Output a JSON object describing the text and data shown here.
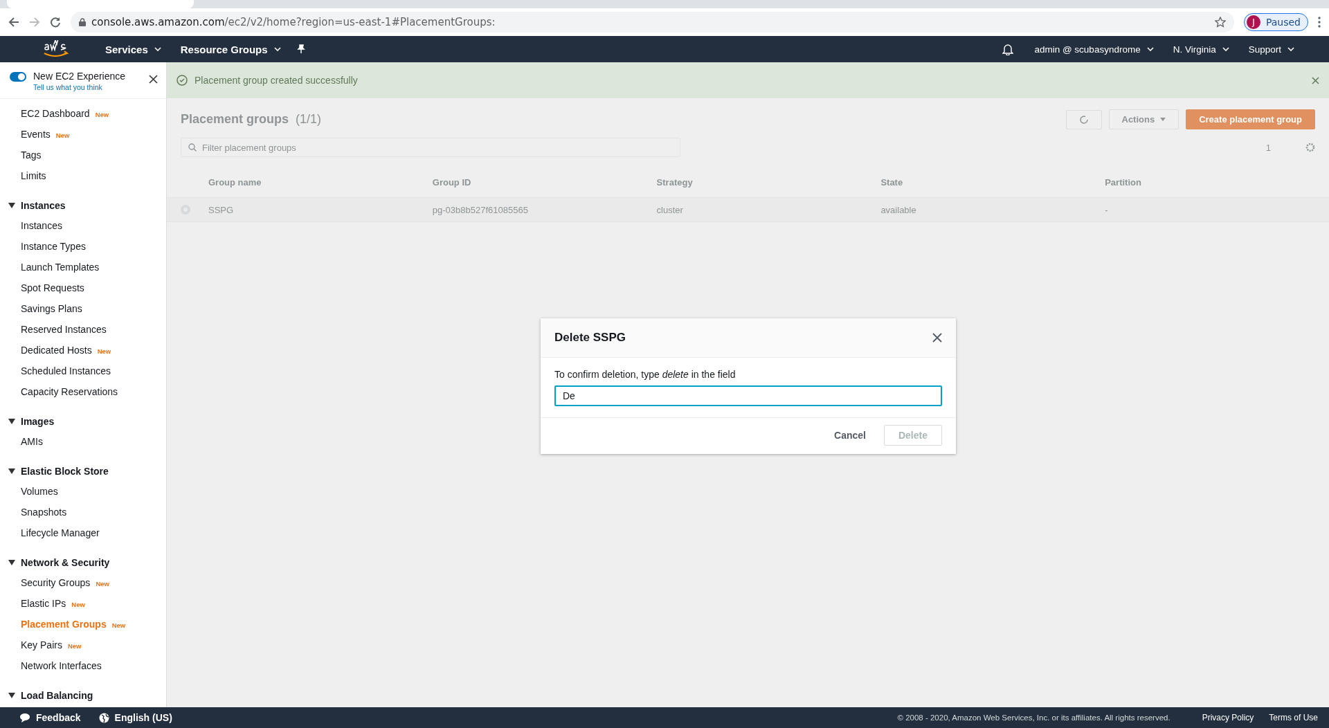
{
  "browser": {
    "url_host": "console.aws.amazon.com",
    "url_path": "/ec2/v2/home?region=us-east-1#PlacementGroups:",
    "profile_initial": "J",
    "profile_label": "Paused"
  },
  "nav": {
    "left": [
      {
        "label": "Services"
      },
      {
        "label": "Resource Groups"
      }
    ],
    "right": [
      {
        "label": "admin @ scubasyndrome"
      },
      {
        "label": "N. Virginia"
      },
      {
        "label": "Support"
      }
    ]
  },
  "sidebar": {
    "toggle": {
      "label": "New EC2 Experience",
      "link": "Tell us what you think",
      "on": true
    },
    "sections": [
      {
        "items": [
          {
            "label": "EC2 Dashboard",
            "badge": "New",
            "selected": false
          },
          {
            "label": "Events",
            "badge": "New",
            "selected": false
          },
          {
            "label": "Tags",
            "selected": false
          },
          {
            "label": "Limits",
            "selected": false
          }
        ]
      },
      {
        "title": "Instances",
        "expanded": true,
        "items": [
          {
            "label": "Instances",
            "selected": false
          },
          {
            "label": "Instance Types",
            "selected": false
          },
          {
            "label": "Launch Templates",
            "selected": false
          },
          {
            "label": "Spot Requests",
            "selected": false
          },
          {
            "label": "Savings Plans",
            "selected": false
          },
          {
            "label": "Reserved Instances",
            "selected": false
          },
          {
            "label": "Dedicated Hosts",
            "badge": "New",
            "selected": false
          },
          {
            "label": "Scheduled Instances",
            "selected": false
          },
          {
            "label": "Capacity Reservations",
            "selected": false
          }
        ]
      },
      {
        "title": "Images",
        "expanded": true,
        "items": [
          {
            "label": "AMIs",
            "selected": false
          }
        ]
      },
      {
        "title": "Elastic Block Store",
        "expanded": true,
        "items": [
          {
            "label": "Volumes",
            "selected": false
          },
          {
            "label": "Snapshots",
            "selected": false
          },
          {
            "label": "Lifecycle Manager",
            "selected": false
          }
        ]
      },
      {
        "title": "Network & Security",
        "expanded": true,
        "items": [
          {
            "label": "Security Groups",
            "badge": "New",
            "selected": false
          },
          {
            "label": "Elastic IPs",
            "badge": "New",
            "selected": false
          },
          {
            "label": "Placement Groups",
            "badge": "New",
            "selected": true
          },
          {
            "label": "Key Pairs",
            "badge": "New",
            "selected": false
          },
          {
            "label": "Network Interfaces",
            "selected": false
          }
        ]
      },
      {
        "title": "Load Balancing",
        "expanded": true
      }
    ]
  },
  "flash": {
    "message": "Placement group created successfully"
  },
  "panel": {
    "title": "Placement groups",
    "count": "(1/1)",
    "actions": "Actions",
    "create": "Create placement group",
    "search_placeholder": "Filter placement groups",
    "page": "1"
  },
  "table": {
    "columns": [
      "Group name",
      "Group ID",
      "Strategy",
      "State",
      "Partition"
    ],
    "rows": [
      {
        "selected": true,
        "cells": [
          "SSPG",
          "pg-03b8b527f61085565",
          "cluster",
          "available",
          "-"
        ]
      }
    ]
  },
  "modal": {
    "title": "Delete SSPG",
    "prompt": "To confirm deletion, type *delete* in the field",
    "value": "De",
    "cancel": "Cancel",
    "confirm": "Delete",
    "confirm_disabled": true
  },
  "footer": {
    "feedback": "Feedback",
    "language": "English (US)",
    "copyright": "© 2008 - 2020, Amazon Web Services, Inc. or its affiliates. All rights reserved.",
    "links": [
      "Privacy Policy",
      "Terms of Use"
    ]
  }
}
